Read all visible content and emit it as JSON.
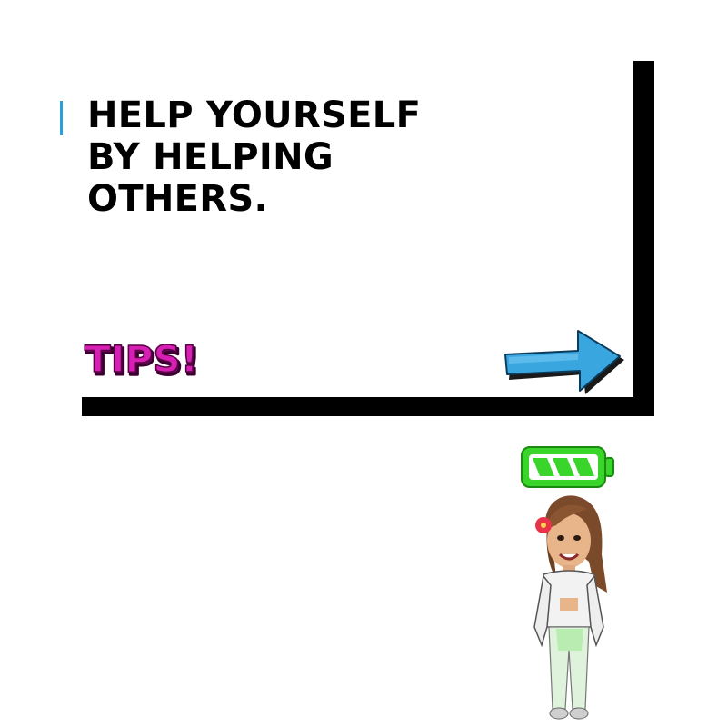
{
  "headline": {
    "line1": "HELP YOURSELF",
    "line2": "BY HELPING",
    "line3": "OTHERS."
  },
  "sticker": {
    "text": "TIPS!",
    "color": "#d61fb3"
  },
  "colors": {
    "accent": "#2b9fd9",
    "frame": "#000000",
    "arrow": "#3aa6e0",
    "battery": "#39d52a"
  },
  "battery": {
    "level": 0.75,
    "icon": "battery-icon"
  },
  "decor": {
    "arrow_icon": "right-arrow-icon",
    "avatar_icon": "bitmoji-avatar"
  }
}
